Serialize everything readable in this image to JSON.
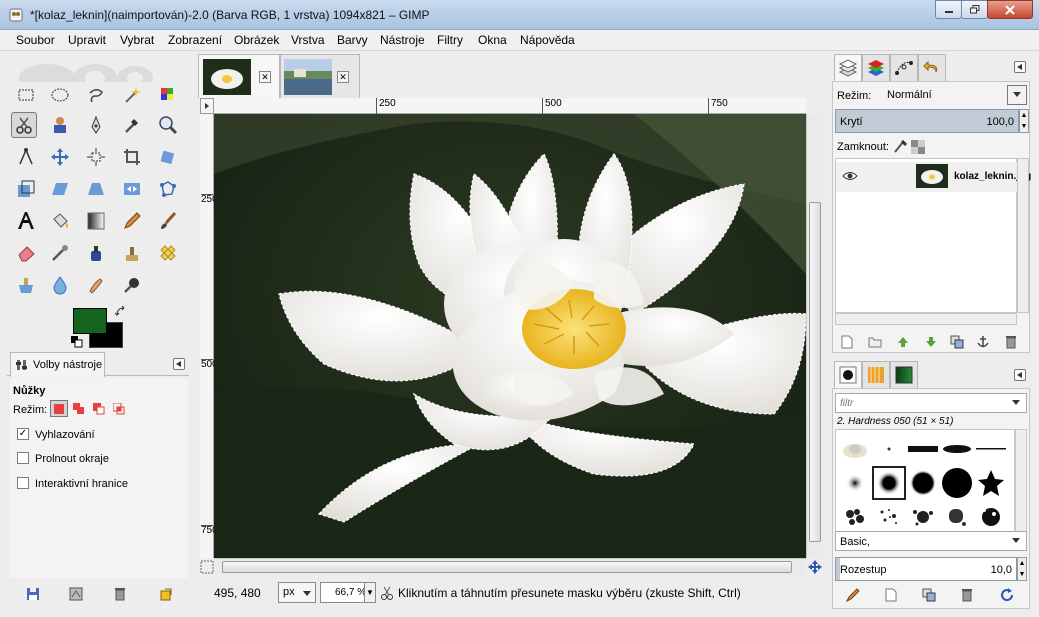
{
  "window": {
    "title": "*[kolaz_leknin](naimportován)-2.0 (Barva RGB, 1 vrstva) 1094x821 – GIMP"
  },
  "menu": [
    "Soubor",
    "Upravit",
    "Vybrat",
    "Zobrazení",
    "Obrázek",
    "Vrstva",
    "Barvy",
    "Nástroje",
    "Filtry",
    "Okna",
    "Nápověda"
  ],
  "colors": {
    "foreground": "#14641e",
    "background": "#000000",
    "accent": "#c1cbd6",
    "selection_marching_ants": "#ffffff"
  },
  "tool_options": {
    "tab_label": "Volby nástroje",
    "tool_name": "Nůžky",
    "mode_label": "Režim:",
    "checkboxes": [
      {
        "label": "Vyhlazování",
        "checked": true
      },
      {
        "label": "Prolnout okraje",
        "checked": false
      },
      {
        "label": "Interaktivní hranice",
        "checked": false
      }
    ]
  },
  "rulers": {
    "horizontal": [
      "250",
      "500",
      "750"
    ],
    "vertical": [
      "250",
      "500",
      "750"
    ]
  },
  "statusbar": {
    "coords": "495, 480",
    "unit": "px",
    "zoom": "66,7 %",
    "message": "Kliknutím a táhnutím přesunete masku výběru (zkuste Shift, Ctrl)"
  },
  "layers": {
    "mode_label": "Režim:",
    "mode_value": "Normální",
    "opacity_label": "Krytí",
    "opacity_value": "100,0",
    "lock_label": "Zamknout:",
    "layer_name": "kolaz_leknin.jpg"
  },
  "brushes": {
    "filter_placeholder": "filtr",
    "selected_brush": "2. Hardness 050 (51 × 51)",
    "preset": "Basic,",
    "spacing_label": "Rozestup",
    "spacing_value": "10,0"
  },
  "icons": {
    "tools": [
      "rect-select-icon",
      "ellipse-select-icon",
      "lasso-icon",
      "fuzzy-select-icon",
      "color-select-icon",
      "scissors-icon",
      "foreground-select-icon",
      "paths-icon",
      "color-picker-icon",
      "zoom-icon",
      "measure-icon",
      "move-icon",
      "align-icon",
      "crop-icon",
      "rotate-icon",
      "scale-icon",
      "shear-icon",
      "perspective-icon",
      "flip-icon",
      "cage-icon",
      "text-icon",
      "bucket-fill-icon",
      "blend-icon",
      "pencil-icon",
      "paintbrush-icon",
      "eraser-icon",
      "airbrush-icon",
      "ink-icon",
      "clone-icon",
      "heal-icon",
      "perspective-clone-icon",
      "blur-icon",
      "smudge-icon",
      "dodge-burn-icon"
    ]
  }
}
